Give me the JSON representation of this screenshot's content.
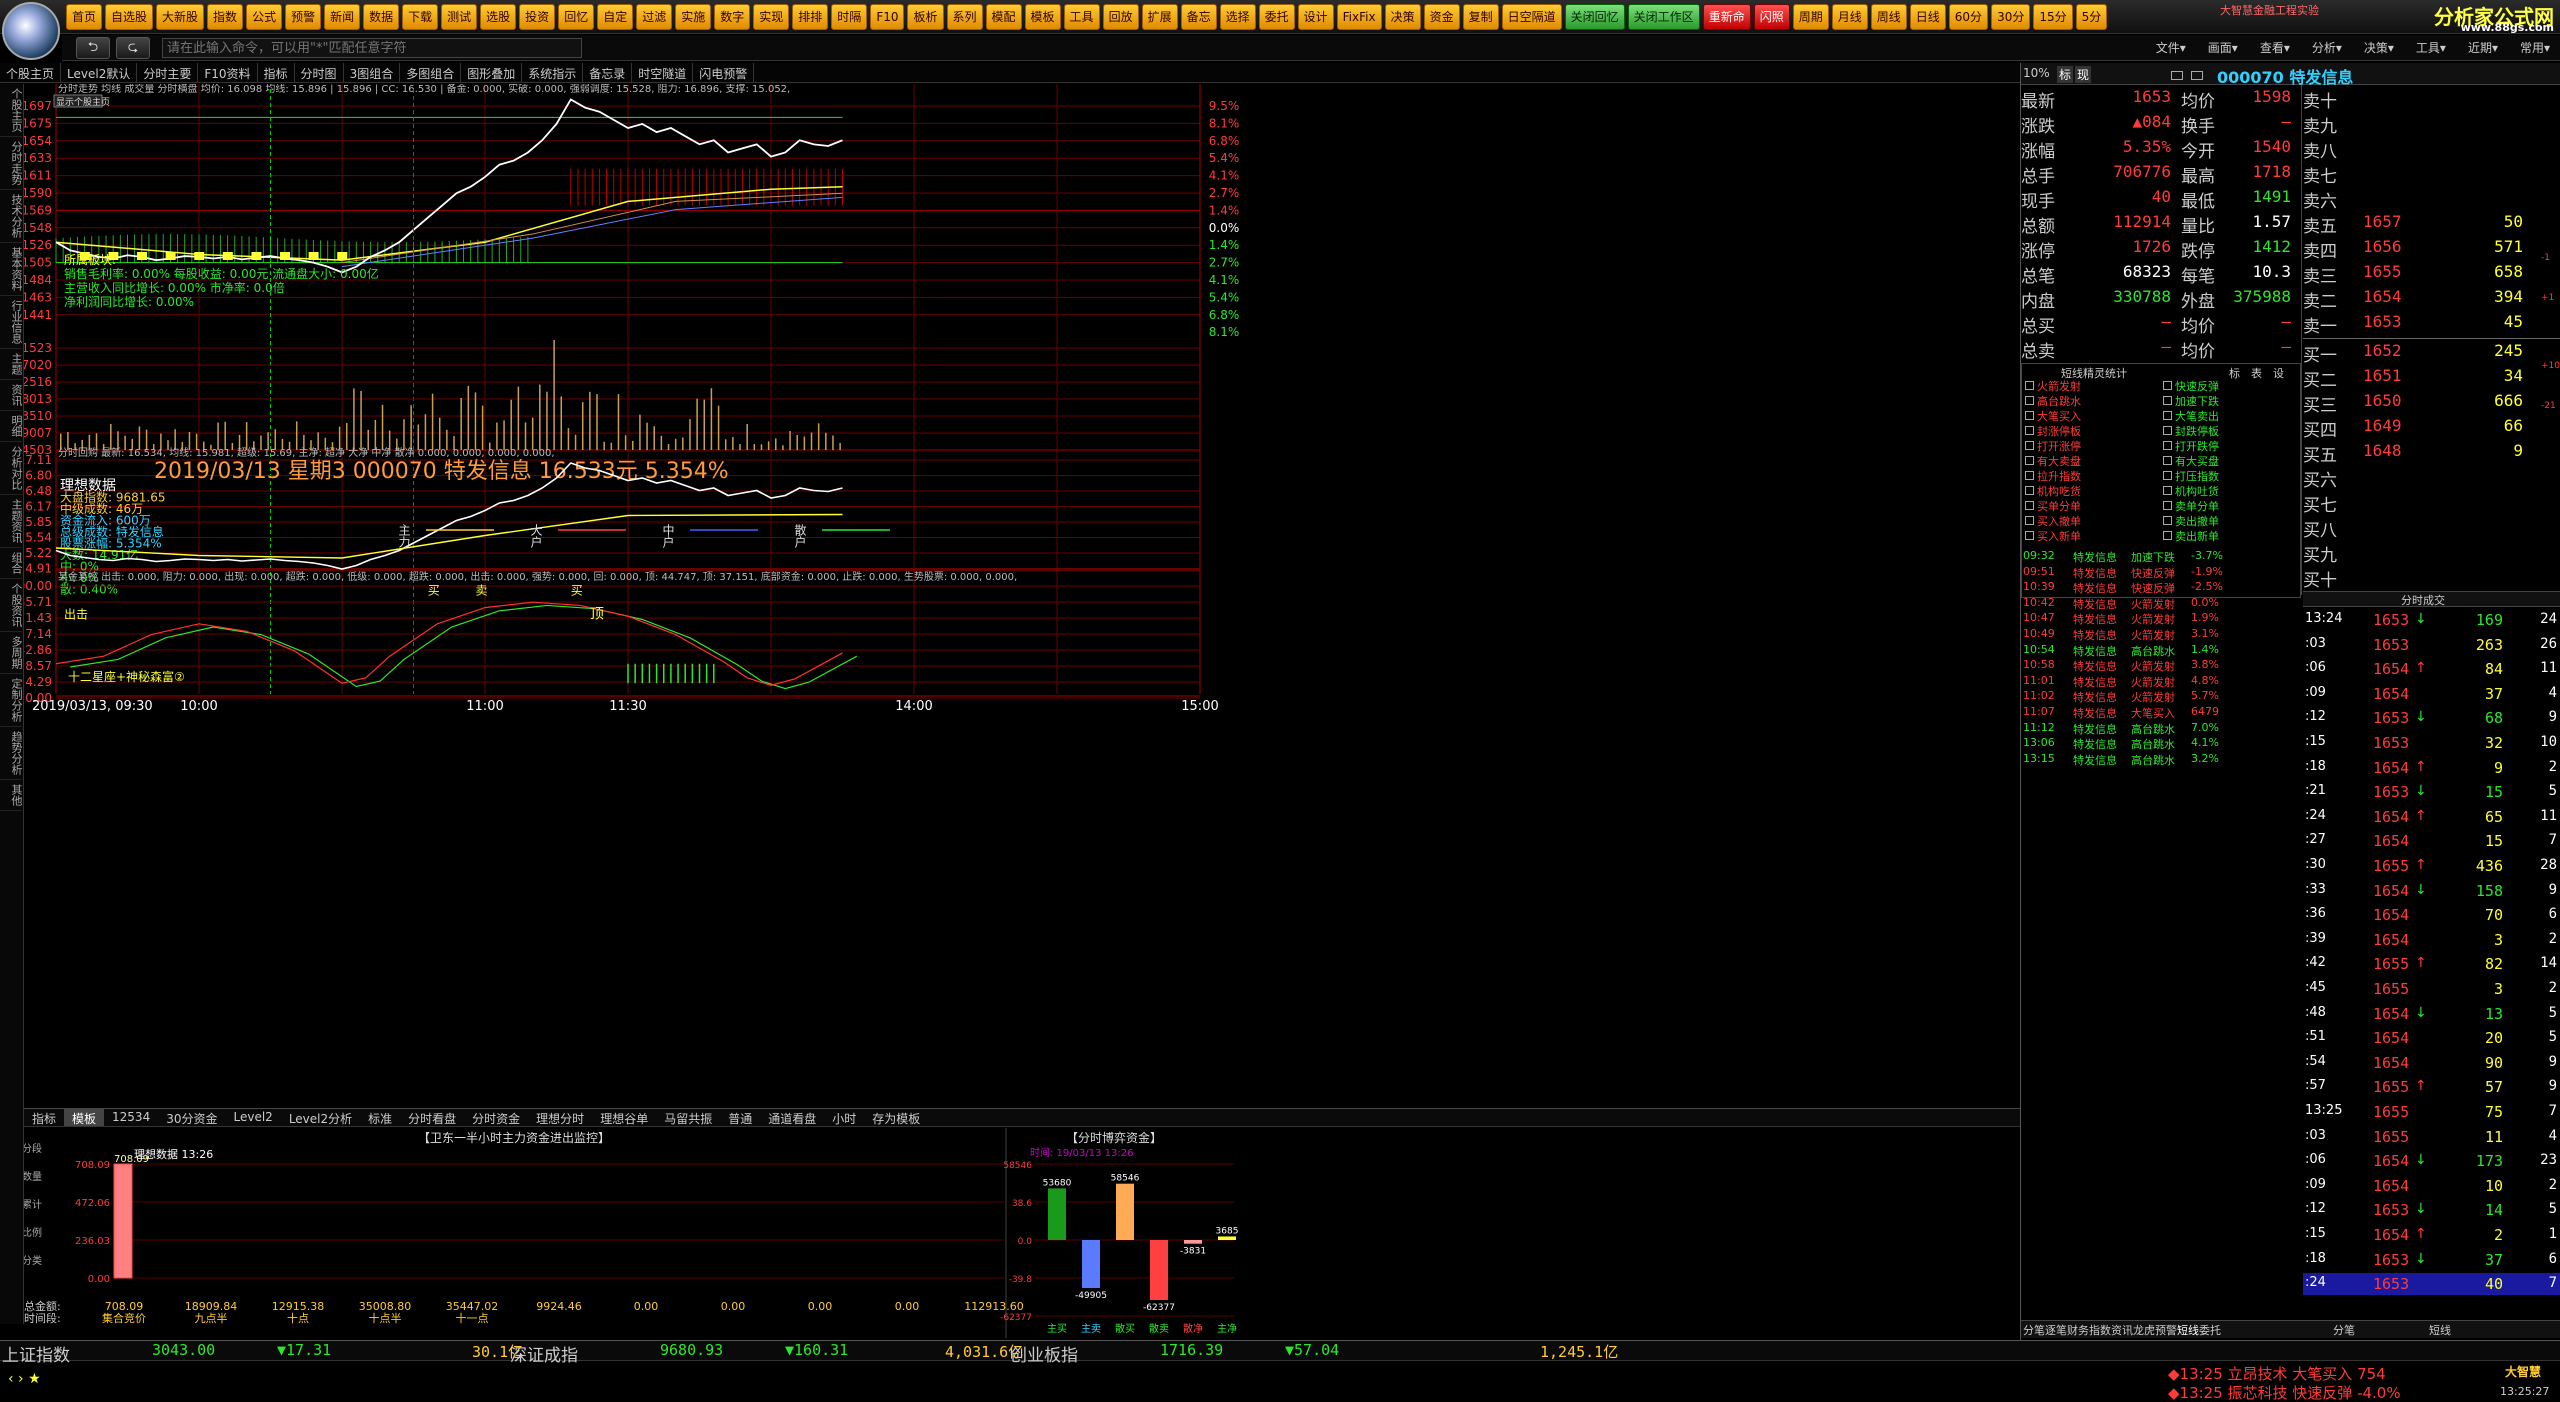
{
  "toolbar": {
    "buttons": [
      "首页",
      "自选股",
      "大新股",
      "指数",
      "公式",
      "预警",
      "新闻",
      "数据",
      "下载",
      "测试",
      "选股",
      "投资",
      "回忆",
      "自定",
      "过滤",
      "实施",
      "数字",
      "实现",
      "排排",
      "时隔",
      "F10",
      "板析",
      "系列",
      "模配",
      "模板",
      "工具",
      "回放",
      "扩展",
      "备忘",
      "选择",
      "委托",
      "设计",
      "FixFix",
      "决策",
      "资金",
      "复制",
      "日空隔道",
      "关闭回忆",
      "关闭工作区",
      "重新命",
      "闪照",
      "周期",
      "月线",
      "周线",
      "日线",
      "60分",
      "30分",
      "15分",
      "5分"
    ],
    "red_buttons": [
      "重新命",
      "闪照"
    ],
    "green_buttons": [
      "关闭回忆",
      "关闭工作区"
    ],
    "brand": "分析家公式网",
    "brand_url": "www.88gs.com",
    "brand_left": "大智慧金融工程实验"
  },
  "cmdbar": {
    "placeholder": "请在此输入命令，可以用\"*\"匹配任意字符",
    "menus": [
      "文件▾",
      "画面▾",
      "查看▾",
      "分析▾",
      "决策▾",
      "工具▾",
      "近期▾",
      "常用▾"
    ]
  },
  "tabs2": [
    "个股主页",
    "Level2默认",
    "分时主要",
    "F10资料",
    "指标",
    "分时图",
    "3图组合",
    "多图组合",
    "图形叠加",
    "系统指示",
    "备忘录",
    "时空隧道",
    "闪电预警"
  ],
  "chart_tabs": [
    "显示个股主页"
  ],
  "sidebar": [
    "个股主页",
    "分时走势",
    "技术分析",
    "基本资料",
    "行业信息",
    "主题",
    "资讯",
    "明细",
    "分析对比",
    "主题资讯",
    "组合",
    "个股资讯",
    "多周期",
    "定制分析",
    "趋势分析",
    "其他"
  ],
  "chart_data": {
    "type": "line",
    "title": "特发信息",
    "x_ticks": [
      "2019/03/13, 09:30",
      "10:00",
      "11:00",
      "11:30",
      "14:00",
      "15:00"
    ],
    "price_axis": [
      "1697",
      "1675",
      "1654",
      "1633",
      "1611",
      "1590",
      "1569",
      "1548",
      "1526",
      "1505",
      "1484",
      "1463",
      "1441"
    ],
    "pct_axis": [
      "9.5%",
      "8.1%",
      "6.8%",
      "5.4%",
      "4.1%",
      "2.7%",
      "1.4%",
      "0.0%",
      "1.4%",
      "2.7%",
      "4.1%",
      "5.4%",
      "6.8%",
      "8.1%"
    ],
    "price_header": "分时走势  均线  成交量  分时横盘   均价: 16.098  均线: 15.896 | 15.896 | CC: 16.530 |  备金: 0.000,  实破: 0.000,  强弱调度: 15.528,  阻力: 16.896,  支撑: 15.052,",
    "vol_axis": [
      "31523",
      "27020",
      "22516",
      "18013",
      "13510",
      "9007",
      "4503"
    ],
    "vol_header": "分时回购  最新: 16.534,  均线: 15.981,  超级: 15.69,  主净: 超净  大净  中净  散净     0.000, 0.000, 0.000, 0.000,",
    "lower_axis": [
      "17.11",
      "16.80",
      "16.48",
      "16.17",
      "15.85",
      "15.54",
      "15.22",
      "14.91"
    ],
    "lower_header": "2019/03/13  星期3    000070  特发信息    16.533元    5.354%",
    "lower_labels": [
      "理想数据",
      "大盘指数: 9681.65",
      "中级成数: 46万",
      "资金流入: 600万",
      "总级成数: 特发信息",
      "股票涨幅: 5.354%",
      "大数: 14.91亿",
      "中:     0%",
      "小:     0%",
      "散:  0.40%"
    ],
    "lower_flow": [
      "主力",
      "大户",
      "中户",
      "散户"
    ],
    "osc_axis": [
      "100.00",
      "85.71",
      "71.43",
      "57.14",
      "42.86",
      "28.57",
      "14.29",
      "0.00"
    ],
    "osc_header": "某金某控 出击: 0.000, 阻力: 0.000, 出现: 0.000, 超跌: 0.000, 低级: 0.000, 超跌: 0.000, 出击: 0.000, 强势: 0.000, 回: 0.000, 顶: 44.747, 顶: 37.151, 底部资金: 0.000, 止跌: 0.000, 生势股票: 0.000, 0.000,",
    "osc_labels": [
      "出击",
      "十二星座+神秘森富②",
      "买",
      "卖",
      "买",
      "顶"
    ],
    "sector_box": [
      "所属板块:",
      "销售毛利率: 0.00%  每股收益: 0.00元  流通盘大小: 0.00亿",
      "主营收入同比增长: 0.00%  市净率: 0.0倍",
      "净利润同比增长: 0.00%"
    ]
  },
  "bottom_tabs": [
    "指标",
    "模板",
    "12534",
    "30分资金",
    "Level2",
    "Level2分析",
    "标准",
    "分时看盘",
    "分时资金",
    "理想分时",
    "理想谷单",
    "马留共振",
    "普通",
    "通道看盘",
    "小时",
    "存为模板"
  ],
  "bottom_panel": {
    "title": "【卫东一半小时主力资金进出监控】",
    "subtitle": "理想数据  13:26",
    "axis": [
      "708.09",
      "472.06",
      "236.03",
      "0.00"
    ],
    "bar_label": "708.09",
    "row1": [
      "708.09",
      "18909.84",
      "12915.38",
      "35008.80",
      "35447.02",
      "9924.46",
      "0.00",
      "0.00",
      "0.00",
      "0.00",
      "112913.60"
    ],
    "row2": [
      "集合竞价",
      "九点半",
      "十点",
      "十点半",
      "十一点"
    ],
    "left_labels": [
      "总金额:",
      "时间段:"
    ],
    "side": [
      "分段",
      "数量",
      "累计",
      "比例",
      "分类"
    ]
  },
  "bottom_right": {
    "title": "【分时博弈资金】",
    "header": "时间: 19/03/13  13:26",
    "values": [
      "53680",
      "-49905",
      "58546",
      "-62377",
      "-3831",
      "3685"
    ],
    "labels": [
      "主买",
      "主卖",
      "散买",
      "散卖",
      "散净",
      "主净"
    ],
    "axis": [
      "58546",
      "38.6",
      "0.0",
      "-39.8",
      "-62377"
    ]
  },
  "status": {
    "items": [
      {
        "name": "上证指数",
        "value": "3043.00",
        "change": "▼17.31",
        "amount": "30.1亿"
      },
      {
        "name": "深证成指",
        "value": "9680.93",
        "change": "▼160.31",
        "amount": "4,031.6亿"
      },
      {
        "name": "创业板指",
        "value": "1716.39",
        "change": "▼57.04",
        "amount": "1,245.1亿"
      }
    ],
    "ticker1": "◆13:25 立昂技术 大笔买入 754",
    "ticker2": "◆13:25 振芯科技 快速反弹 -4.0%",
    "time": "13:25:27",
    "brand": "大智慧"
  },
  "right": {
    "code_title": "000070 特发信息",
    "pct_label": "10%",
    "hdr_btns": [
      "标",
      "现"
    ],
    "quote": [
      [
        "最新",
        "1653",
        "均价",
        "1598"
      ],
      [
        "涨跌",
        "▲084",
        "换手",
        "—"
      ],
      [
        "涨幅",
        "5.35%",
        "今开",
        "1540"
      ],
      [
        "总手",
        "706776",
        "最高",
        "1718"
      ],
      [
        "现手",
        "40",
        "最低",
        "1491"
      ],
      [
        "总额",
        "112914",
        "量比",
        "1.57"
      ],
      [
        "涨停",
        "1726",
        "跌停",
        "1412"
      ],
      [
        "总笔",
        "68323",
        "每笔",
        "10.3"
      ],
      [
        "内盘",
        "330788",
        "外盘",
        "375988"
      ],
      [
        "总买",
        "—",
        "均价",
        "—"
      ],
      [
        "总卖",
        "—",
        "均价",
        "—"
      ]
    ],
    "sells": [
      [
        "卖十",
        "",
        ""
      ],
      [
        "卖九",
        "",
        ""
      ],
      [
        "卖八",
        "",
        ""
      ],
      [
        "卖七",
        "",
        ""
      ],
      [
        "卖六",
        "",
        ""
      ],
      [
        "卖五",
        "1657",
        "50"
      ],
      [
        "卖四",
        "1656",
        "571"
      ],
      [
        "卖三",
        "1655",
        "658"
      ],
      [
        "卖二",
        "1654",
        "394"
      ],
      [
        "卖一",
        "1653",
        "45"
      ]
    ],
    "buys": [
      [
        "买一",
        "1652",
        "245"
      ],
      [
        "买二",
        "1651",
        "34"
      ],
      [
        "买三",
        "1650",
        "666"
      ],
      [
        "买四",
        "1649",
        "66"
      ],
      [
        "买五",
        "1648",
        "9"
      ],
      [
        "买六",
        "",
        ""
      ],
      [
        "买七",
        "",
        ""
      ],
      [
        "买八",
        "",
        ""
      ],
      [
        "买九",
        "",
        ""
      ],
      [
        "买十",
        "",
        ""
      ]
    ],
    "side_marks": [
      "-1",
      "+1",
      "+10",
      "-21"
    ],
    "radar_title": "短线精灵统计",
    "radar_btns": [
      "标",
      "表",
      "设"
    ],
    "radar_left": [
      "火箭发射",
      "高台跳水",
      "大笔买入",
      "封涨停板",
      "打开涨停",
      "有大卖盘",
      "拉升指数",
      "机构吃货",
      "买单分单",
      "买入撤单",
      "买入新单"
    ],
    "radar_right": [
      "快速反弹",
      "加速下跌",
      "大笔卖出",
      "封跌停板",
      "打开跌停",
      "有大买盘",
      "打压指数",
      "机构吐货",
      "卖单分单",
      "卖出撤单",
      "卖出新单"
    ],
    "radar_log": [
      [
        "09:32",
        "特发信息",
        "加速下跌",
        "-3.7%"
      ],
      [
        "09:51",
        "特发信息",
        "快速反弹",
        "-1.9%"
      ],
      [
        "10:39",
        "特发信息",
        "快速反弹",
        "-2.5%"
      ],
      [
        "10:42",
        "特发信息",
        "火箭发射",
        "0.0%"
      ],
      [
        "10:47",
        "特发信息",
        "火箭发射",
        "1.9%"
      ],
      [
        "10:49",
        "特发信息",
        "火箭发射",
        "3.1%"
      ],
      [
        "10:54",
        "特发信息",
        "高台跳水",
        "1.4%"
      ],
      [
        "10:58",
        "特发信息",
        "火箭发射",
        "3.8%"
      ],
      [
        "11:01",
        "特发信息",
        "火箭发射",
        "4.8%"
      ],
      [
        "11:02",
        "特发信息",
        "火箭发射",
        "5.7%"
      ],
      [
        "11:07",
        "特发信息",
        "大笔买入",
        "6479"
      ],
      [
        "11:12",
        "特发信息",
        "高台跳水",
        "7.0%"
      ],
      [
        "13:06",
        "特发信息",
        "高台跳水",
        "4.1%"
      ],
      [
        "13:15",
        "特发信息",
        "高台跳水",
        "3.2%"
      ]
    ],
    "tick_title": "分时成交",
    "ticks": [
      [
        "13:24",
        "1653",
        "↓",
        "169",
        "24"
      ],
      [
        ":03",
        "1653",
        "",
        "263",
        "26"
      ],
      [
        ":06",
        "1654",
        "↑",
        "84",
        "11"
      ],
      [
        ":09",
        "1654",
        "",
        "37",
        "4"
      ],
      [
        ":12",
        "1653",
        "↓",
        "68",
        "9"
      ],
      [
        ":15",
        "1653",
        "",
        "32",
        "10"
      ],
      [
        ":18",
        "1654",
        "↑",
        "9",
        "2"
      ],
      [
        ":21",
        "1653",
        "↓",
        "15",
        "5"
      ],
      [
        ":24",
        "1654",
        "↑",
        "65",
        "11"
      ],
      [
        ":27",
        "1654",
        "",
        "15",
        "7"
      ],
      [
        ":30",
        "1655",
        "↑",
        "436",
        "28"
      ],
      [
        ":33",
        "1654",
        "↓",
        "158",
        "9"
      ],
      [
        ":36",
        "1654",
        "",
        "70",
        "6"
      ],
      [
        ":39",
        "1654",
        "",
        "3",
        "2"
      ],
      [
        ":42",
        "1655",
        "↑",
        "82",
        "14"
      ],
      [
        ":45",
        "1655",
        "",
        "3",
        "2"
      ],
      [
        ":48",
        "1654",
        "↓",
        "13",
        "5"
      ],
      [
        ":51",
        "1654",
        "",
        "20",
        "5"
      ],
      [
        ":54",
        "1654",
        "",
        "90",
        "9"
      ],
      [
        ":57",
        "1655",
        "↑",
        "57",
        "9"
      ],
      [
        "13:25",
        "1655",
        "",
        "75",
        "7"
      ],
      [
        ":03",
        "1655",
        "",
        "11",
        "4"
      ],
      [
        ":06",
        "1654",
        "↓",
        "173",
        "23"
      ],
      [
        ":09",
        "1654",
        "",
        "10",
        "2"
      ],
      [
        ":12",
        "1653",
        "↓",
        "14",
        "5"
      ],
      [
        ":15",
        "1654",
        "↑",
        "2",
        "1"
      ],
      [
        ":18",
        "1653",
        "↓",
        "37",
        "6"
      ],
      [
        ":24",
        "1653",
        "",
        "40",
        "7"
      ]
    ],
    "bottom_tabs_l": [
      "分笔",
      "逐笔",
      "财务",
      "指数",
      "资讯",
      "龙虎",
      "预警",
      "短线",
      "委托"
    ],
    "bottom_tabs_r": [
      "分笔",
      "短线"
    ]
  }
}
